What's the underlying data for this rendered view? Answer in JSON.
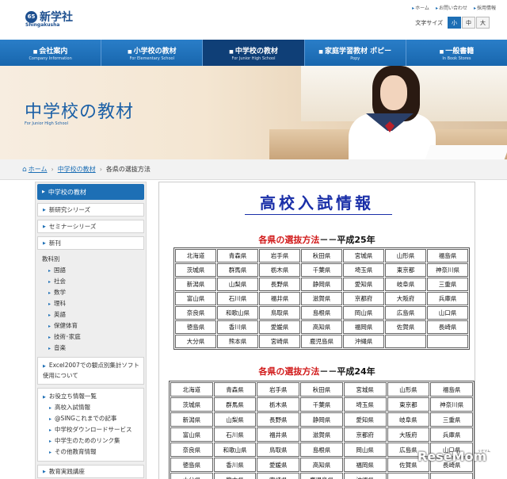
{
  "header": {
    "logo_mark": "65",
    "logo_text": "新学社",
    "logo_sub": "Shingakusha",
    "toplinks": [
      "ホーム",
      "お問い合わせ",
      "採用情報"
    ],
    "fontsize_label": "文字サイズ",
    "fontsize_options": [
      "小",
      "中",
      "大"
    ],
    "fontsize_selected": "小"
  },
  "nav": [
    {
      "label": "会社案内",
      "sub": "Company Information"
    },
    {
      "label": "小学校の教材",
      "sub": "For Elementary School"
    },
    {
      "label": "中学校の教材",
      "sub": "For Junior High School"
    },
    {
      "label": "家庭学習教材 ポピー",
      "sub": "Popy"
    },
    {
      "label": "一般書籍",
      "sub": "In Book Stores"
    }
  ],
  "banner": {
    "title": "中学校の教材",
    "subtitle": "For Junior High School"
  },
  "breadcrumb": {
    "home": "ホーム",
    "parent": "中学校の教材",
    "current": "各県の選抜方法"
  },
  "sidebar": {
    "head": "中学校の教材",
    "buttons": [
      "新研究シリーズ",
      "セミナーシリーズ",
      "新刊"
    ],
    "subjects_label": "教科別",
    "subjects": [
      "国語",
      "社会",
      "数学",
      "理科",
      "英語",
      "保健体育",
      "技術･家庭",
      "音楽"
    ],
    "excel_box": "Excel2007での観点別集計ソフト使用について",
    "info_head": "お役立ち情報一覧",
    "info_items": [
      "高校入試情報",
      "@SINGこれまでの記事",
      "中学校ダウンロードサービス",
      "中学生のためのリンク集",
      "その他教育情報"
    ],
    "last_btn": "教育実践講座"
  },
  "main": {
    "title": "高校入試情報",
    "section1": {
      "red": "各県の選抜方法",
      "black": "－－平成25年"
    },
    "section2": {
      "red": "各県の選抜方法",
      "black": "－－平成24年"
    },
    "prefectures": [
      [
        "北海道",
        "青森県",
        "岩手県",
        "秋田県",
        "宮城県",
        "山形県",
        "福島県"
      ],
      [
        "茨城県",
        "群馬県",
        "栃木県",
        "千葉県",
        "埼玉県",
        "東京都",
        "神奈川県"
      ],
      [
        "新潟県",
        "山梨県",
        "長野県",
        "静岡県",
        "愛知県",
        "岐阜県",
        "三重県"
      ],
      [
        "富山県",
        "石川県",
        "福井県",
        "滋賀県",
        "京都府",
        "大阪府",
        "兵庫県"
      ],
      [
        "奈良県",
        "和歌山県",
        "鳥取県",
        "島根県",
        "岡山県",
        "広島県",
        "山口県"
      ],
      [
        "徳島県",
        "香川県",
        "愛媛県",
        "高知県",
        "福岡県",
        "佐賀県",
        "長崎県"
      ],
      [
        "大分県",
        "熊本県",
        "宮崎県",
        "鹿児島県",
        "沖縄県",
        "",
        ""
      ]
    ]
  },
  "watermark": {
    "text": "ReseMom",
    "sub": "リセマム"
  }
}
